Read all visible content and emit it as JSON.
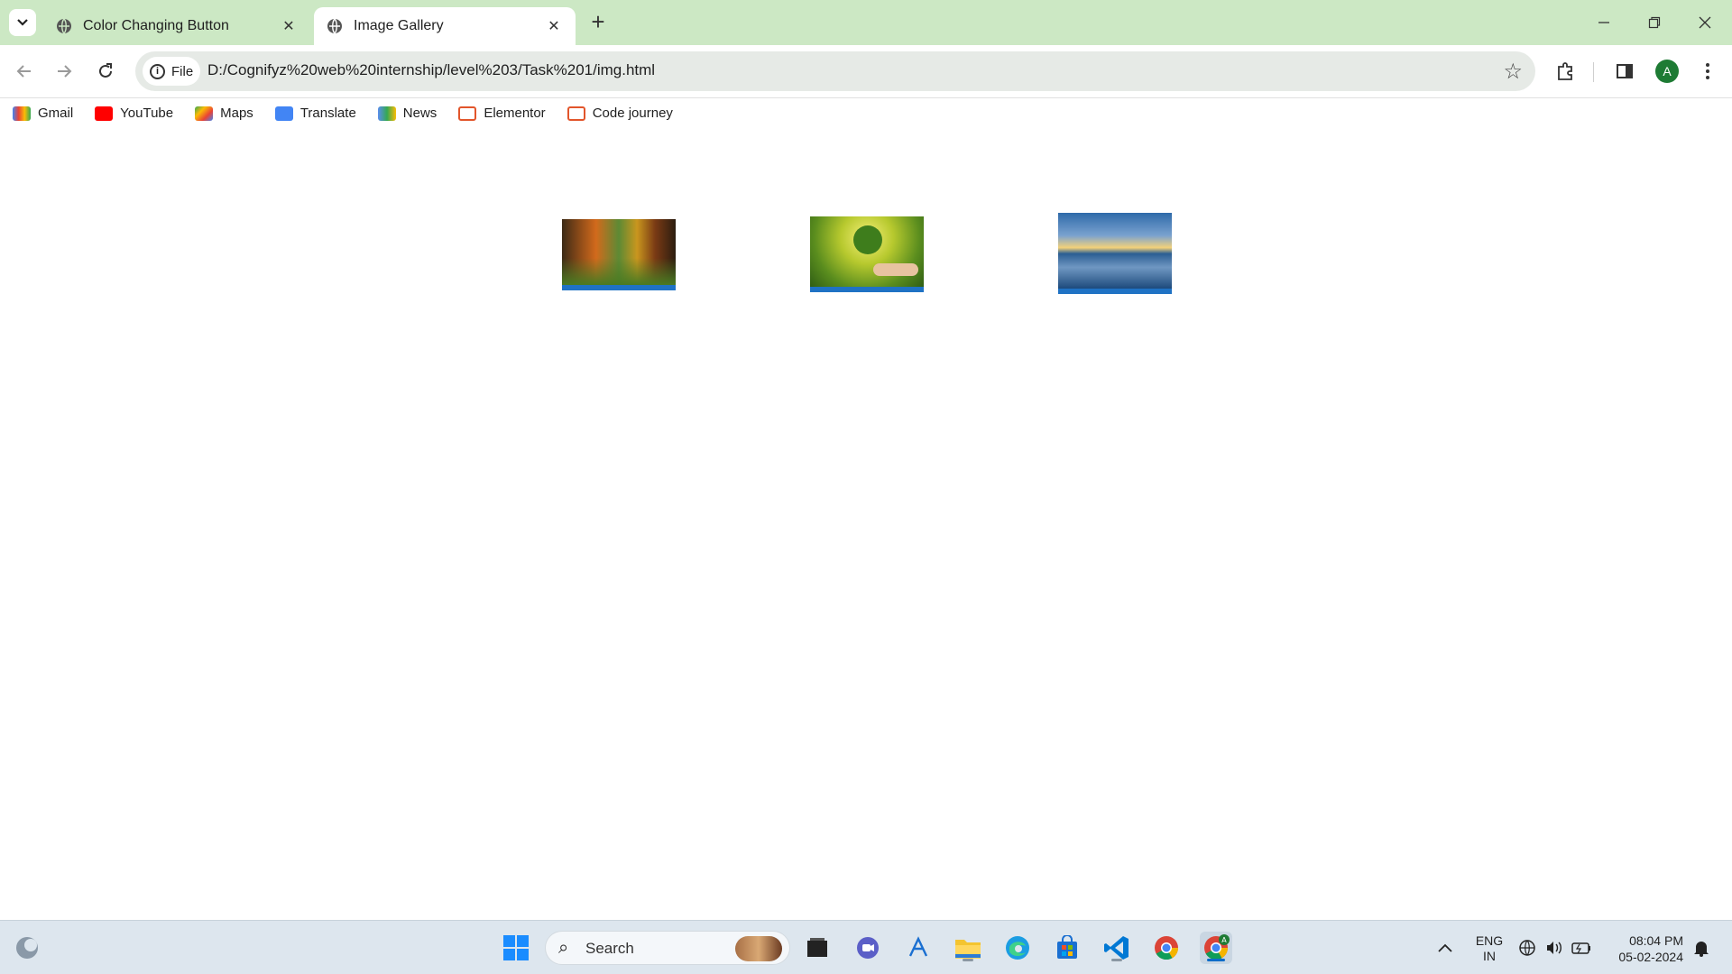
{
  "browser": {
    "tabs": [
      {
        "label": "Color Changing Button",
        "active": false
      },
      {
        "label": "Image Gallery",
        "active": true
      }
    ],
    "address": {
      "chip": "File",
      "url": "D:/Cognifyz%20web%20internship/level%203/Task%201/img.html"
    },
    "profile_initial": "A",
    "bookmarks": [
      {
        "label": "Gmail",
        "icon": "gmail-icon",
        "color": "#ea4335"
      },
      {
        "label": "YouTube",
        "icon": "youtube-icon",
        "color": "#ff0000"
      },
      {
        "label": "Maps",
        "icon": "maps-icon",
        "color": "#34a853"
      },
      {
        "label": "Translate",
        "icon": "translate-icon",
        "color": "#4285f4"
      },
      {
        "label": "News",
        "icon": "news-icon",
        "color": "#5b8def"
      },
      {
        "label": "Elementor",
        "icon": "elementor-icon",
        "color": "#e2552b"
      },
      {
        "label": "Code journey",
        "icon": "code-journey-icon",
        "color": "#e2552b"
      }
    ]
  },
  "gallery": {
    "images": [
      {
        "name": "forest-image"
      },
      {
        "name": "tree-in-hand-image"
      },
      {
        "name": "sunset-lake-image"
      }
    ]
  },
  "taskbar": {
    "search_label": "Search",
    "language_line1": "ENG",
    "language_line2": "IN",
    "time": "08:04 PM",
    "date": "05-02-2024"
  }
}
